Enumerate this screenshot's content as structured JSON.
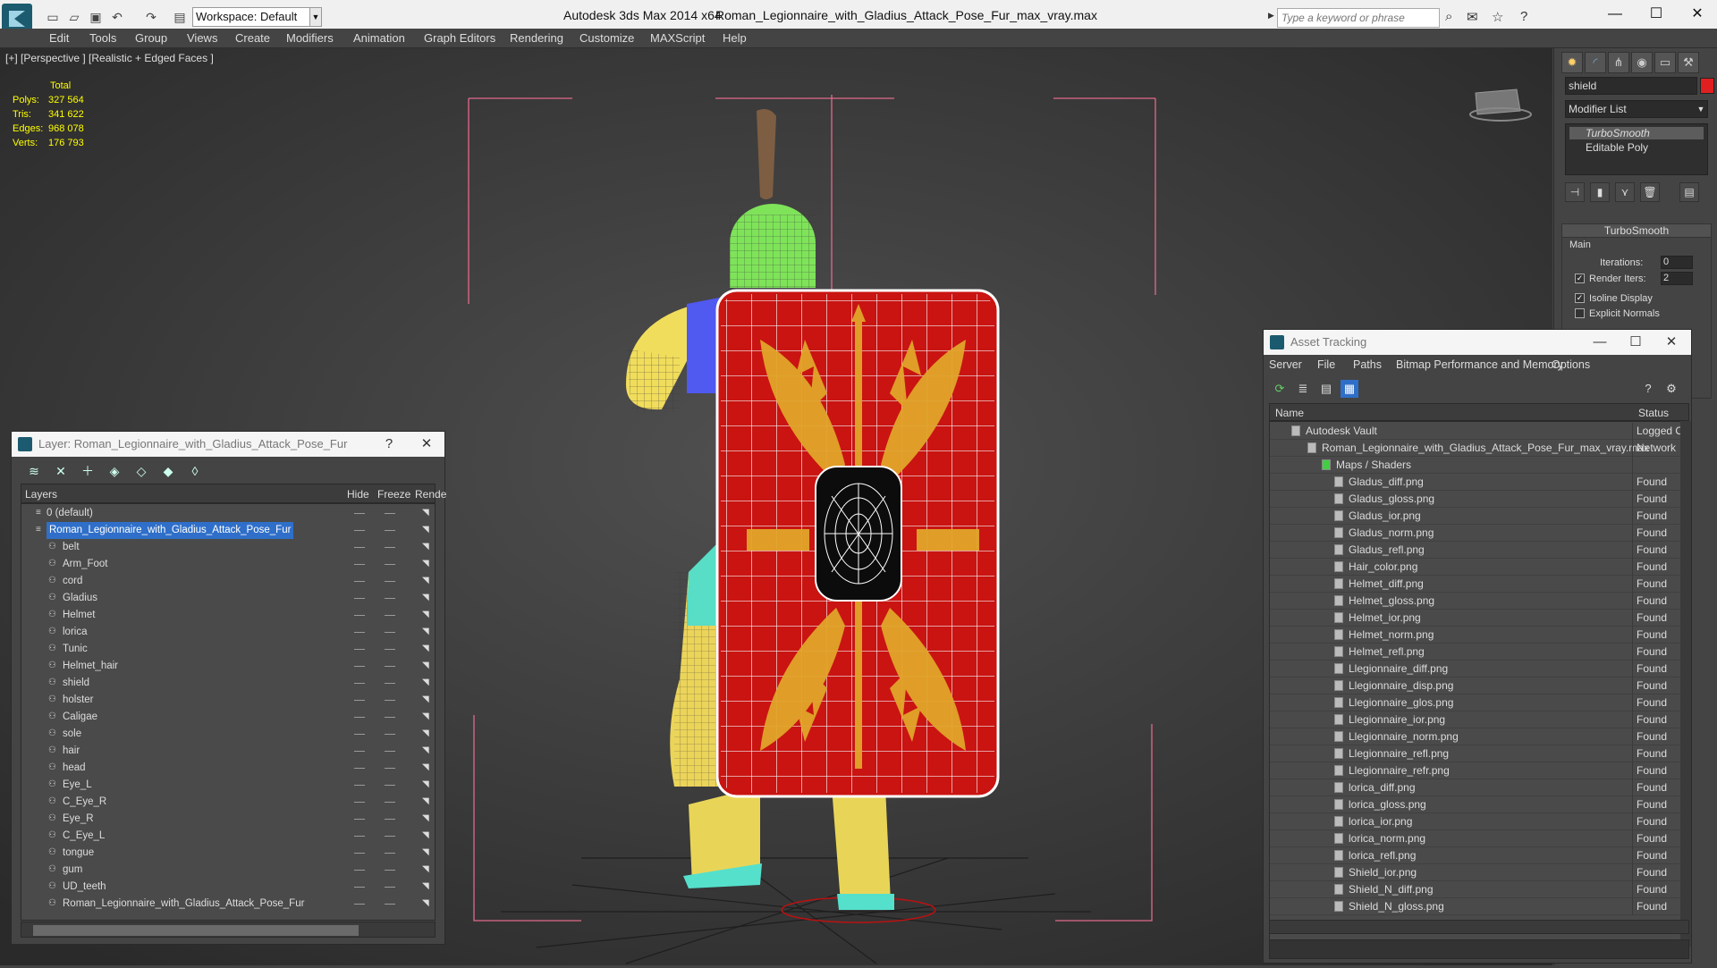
{
  "app": {
    "title": "Autodesk 3ds Max  2014 x64",
    "file": "Roman_Legionnaire_with_Gladius_Attack_Pose_Fur_max_vray.max",
    "workspace": "Workspace: Default",
    "search_placeholder": "Type a keyword or phrase"
  },
  "menu": [
    "Edit",
    "Tools",
    "Group",
    "Views",
    "Create",
    "Modifiers",
    "Animation",
    "Graph Editors",
    "Rendering",
    "Customize",
    "MAXScript",
    "Help"
  ],
  "viewport": {
    "label": "[+] [Perspective ] [Realistic + Edged Faces ]",
    "stats": {
      "header": "Total",
      "rows": [
        {
          "k": "Polys:",
          "v": "327 564"
        },
        {
          "k": "Tris:",
          "v": "341 622"
        },
        {
          "k": "Edges:",
          "v": "968 078"
        },
        {
          "k": "Verts:",
          "v": "176 793"
        }
      ]
    }
  },
  "command_panel": {
    "object_name": "shield",
    "object_color": "#e02020",
    "modifier_list": "Modifier List",
    "stack": [
      "TurboSmooth",
      "Editable Poly"
    ],
    "rollout": {
      "title": "TurboSmooth",
      "section": "Main",
      "iterations_label": "Iterations:",
      "iterations_value": "0",
      "render_iters_label": "Render Iters:",
      "render_iters_value": "2",
      "isoline": "Isoline Display",
      "explicit": "Explicit Normals"
    }
  },
  "layer_window": {
    "title": "Layer: Roman_Legionnaire_with_Gladius_Attack_Pose_Fur",
    "help": "?",
    "columns": [
      "Layers",
      "Hide",
      "Freeze",
      "Rende"
    ],
    "layers": [
      {
        "name": "0 (default)",
        "level": 0
      },
      {
        "name": "Roman_Legionnaire_with_Gladius_Attack_Pose_Fur",
        "level": 0,
        "selected": true
      },
      {
        "name": "belt",
        "level": 1
      },
      {
        "name": "Arm_Foot",
        "level": 1
      },
      {
        "name": "cord",
        "level": 1
      },
      {
        "name": "Gladius",
        "level": 1
      },
      {
        "name": "Helmet",
        "level": 1
      },
      {
        "name": "lorica",
        "level": 1
      },
      {
        "name": "Tunic",
        "level": 1
      },
      {
        "name": "Helmet_hair",
        "level": 1
      },
      {
        "name": "shield",
        "level": 1
      },
      {
        "name": "holster",
        "level": 1
      },
      {
        "name": "Caligae",
        "level": 1
      },
      {
        "name": "sole",
        "level": 1
      },
      {
        "name": "hair",
        "level": 1
      },
      {
        "name": "head",
        "level": 1
      },
      {
        "name": "Eye_L",
        "level": 1
      },
      {
        "name": "C_Eye_R",
        "level": 1
      },
      {
        "name": "Eye_R",
        "level": 1
      },
      {
        "name": "C_Eye_L",
        "level": 1
      },
      {
        "name": "tongue",
        "level": 1
      },
      {
        "name": "gum",
        "level": 1
      },
      {
        "name": "UD_teeth",
        "level": 1
      },
      {
        "name": "Roman_Legionnaire_with_Gladius_Attack_Pose_Fur",
        "level": 1
      }
    ]
  },
  "asset_window": {
    "title": "Asset Tracking",
    "menu": [
      "Server",
      "File",
      "Paths",
      "Bitmap Performance and Memory",
      "Options"
    ],
    "columns": [
      "Name",
      "Status"
    ],
    "rows": [
      {
        "name": "Autodesk Vault",
        "status": "Logged O",
        "level": 1
      },
      {
        "name": "Roman_Legionnaire_with_Gladius_Attack_Pose_Fur_max_vray.max",
        "status": "Network",
        "level": 2
      },
      {
        "name": "Maps / Shaders",
        "status": "",
        "level": 3
      },
      {
        "name": "Gladus_diff.png",
        "status": "Found",
        "level": 4
      },
      {
        "name": "Gladus_gloss.png",
        "status": "Found",
        "level": 4
      },
      {
        "name": "Gladus_ior.png",
        "status": "Found",
        "level": 4
      },
      {
        "name": "Gladus_norm.png",
        "status": "Found",
        "level": 4
      },
      {
        "name": "Gladus_refl.png",
        "status": "Found",
        "level": 4
      },
      {
        "name": "Hair_color.png",
        "status": "Found",
        "level": 4
      },
      {
        "name": "Helmet_diff.png",
        "status": "Found",
        "level": 4
      },
      {
        "name": "Helmet_gloss.png",
        "status": "Found",
        "level": 4
      },
      {
        "name": "Helmet_ior.png",
        "status": "Found",
        "level": 4
      },
      {
        "name": "Helmet_norm.png",
        "status": "Found",
        "level": 4
      },
      {
        "name": "Helmet_refl.png",
        "status": "Found",
        "level": 4
      },
      {
        "name": "Llegionnaire_diff.png",
        "status": "Found",
        "level": 4
      },
      {
        "name": "Llegionnaire_disp.png",
        "status": "Found",
        "level": 4
      },
      {
        "name": "Llegionnaire_glos.png",
        "status": "Found",
        "level": 4
      },
      {
        "name": "Llegionnaire_ior.png",
        "status": "Found",
        "level": 4
      },
      {
        "name": "Llegionnaire_norm.png",
        "status": "Found",
        "level": 4
      },
      {
        "name": "Llegionnaire_refl.png",
        "status": "Found",
        "level": 4
      },
      {
        "name": "Llegionnaire_refr.png",
        "status": "Found",
        "level": 4
      },
      {
        "name": "lorica_diff.png",
        "status": "Found",
        "level": 4
      },
      {
        "name": "lorica_gloss.png",
        "status": "Found",
        "level": 4
      },
      {
        "name": "lorica_ior.png",
        "status": "Found",
        "level": 4
      },
      {
        "name": "lorica_norm.png",
        "status": "Found",
        "level": 4
      },
      {
        "name": "lorica_refl.png",
        "status": "Found",
        "level": 4
      },
      {
        "name": "Shield_ior.png",
        "status": "Found",
        "level": 4
      },
      {
        "name": "Shield_N_diff.png",
        "status": "Found",
        "level": 4
      },
      {
        "name": "Shield_N_gloss.png",
        "status": "Found",
        "level": 4
      }
    ]
  }
}
